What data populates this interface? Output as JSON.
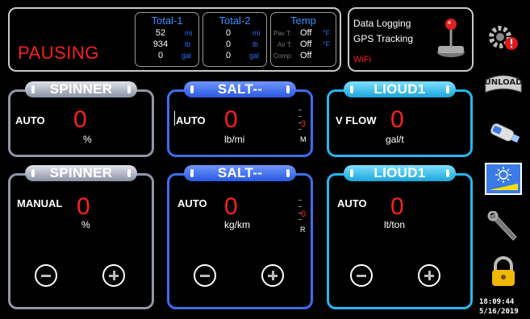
{
  "status": {
    "text": "PAUSING"
  },
  "totals": {
    "total1": {
      "title": "Total-1",
      "rows": [
        {
          "value": "52",
          "unit": "mi"
        },
        {
          "value": "934",
          "unit": "lb"
        },
        {
          "value": "0",
          "unit": "gal"
        }
      ]
    },
    "total2": {
      "title": "Total-2",
      "rows": [
        {
          "value": "0",
          "unit": "mi"
        },
        {
          "value": "0",
          "unit": "lb"
        },
        {
          "value": "0",
          "unit": "gal"
        }
      ]
    },
    "temp": {
      "title": "Temp",
      "rows": [
        {
          "label": "Pav T:",
          "value": "Off",
          "unit": "°F"
        },
        {
          "label": "Air T:",
          "value": "Off",
          "unit": "°F"
        },
        {
          "label": "Comp:",
          "value": "Off",
          "unit": ""
        }
      ]
    }
  },
  "logging": {
    "data_logging": "Data Logging",
    "gps_tracking": "GPS Tracking",
    "wifi": "WiFi"
  },
  "panels": [
    {
      "title": "SPINNER",
      "mode": "AUTO",
      "value": "0",
      "unit": "%",
      "color": "grey"
    },
    {
      "title": "SALT--",
      "mode": "AUTO",
      "value": "0",
      "unit": "lb/mi",
      "color": "blue",
      "scale_value": "3",
      "scale_letter": "M"
    },
    {
      "title": "LIOUD1",
      "mode": "V FLOW",
      "value": "0",
      "unit": "gal/t",
      "color": "cyan"
    },
    {
      "title": "SPINNER",
      "mode": "MANUAL",
      "value": "0",
      "unit": "%",
      "color": "grey"
    },
    {
      "title": "SALT--",
      "mode": "AUTO",
      "value": "0",
      "unit": "kg/km",
      "color": "blue",
      "scale_value": "0",
      "scale_letter": "R"
    },
    {
      "title": "LIOUD1",
      "mode": "AUTO",
      "value": "0",
      "unit": "lt/ton",
      "color": "cyan"
    }
  ],
  "sidebar": {
    "unload": "UNLOAD"
  },
  "clock": {
    "time": "18:09:44",
    "date": "5/16/2019"
  },
  "colors": {
    "accent_red": "#ff2020",
    "blue": "#3c6ef0",
    "cyan": "#25b8ee",
    "grey": "#8f96a6"
  },
  "icons": [
    "settings-alert-icon",
    "unload-icon",
    "usb-drive-icon",
    "brightness-icon",
    "wrench-icon",
    "lock-icon",
    "joystick-icon"
  ]
}
